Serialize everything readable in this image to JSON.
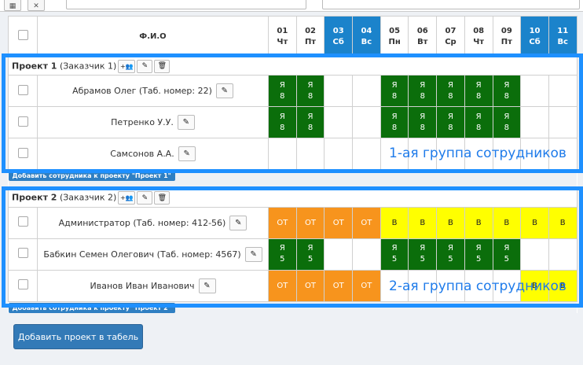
{
  "days": [
    {
      "num": "01",
      "dow": "Чт",
      "weekend": false
    },
    {
      "num": "02",
      "dow": "Пт",
      "weekend": false
    },
    {
      "num": "03",
      "dow": "Сб",
      "weekend": true
    },
    {
      "num": "04",
      "dow": "Вс",
      "weekend": true
    },
    {
      "num": "05",
      "dow": "Пн",
      "weekend": false
    },
    {
      "num": "06",
      "dow": "Вт",
      "weekend": false
    },
    {
      "num": "07",
      "dow": "Ср",
      "weekend": false
    },
    {
      "num": "08",
      "dow": "Чт",
      "weekend": false
    },
    {
      "num": "09",
      "dow": "Пт",
      "weekend": false
    },
    {
      "num": "10",
      "dow": "Сб",
      "weekend": true
    },
    {
      "num": "11",
      "dow": "Вс",
      "weekend": true
    }
  ],
  "header": {
    "fio": "Ф.И.О"
  },
  "projects": [
    {
      "name": "Проект 1",
      "customer": "(Заказчик 1)",
      "add_label": "Добавить сотрудника к проекту \"Проект 1\"",
      "note": "1-ая группа сотрудников",
      "employees": [
        {
          "name": "Абрамов Олег (Таб. номер: 22)",
          "cells": [
            [
              "Я",
              "8"
            ],
            [
              "Я",
              "8"
            ],
            null,
            null,
            [
              "Я",
              "8"
            ],
            [
              "Я",
              "8"
            ],
            [
              "Я",
              "8"
            ],
            [
              "Я",
              "8"
            ],
            [
              "Я",
              "8"
            ],
            null,
            null
          ],
          "kind": "ya"
        },
        {
          "name": "Петренко У.У.",
          "cells": [
            [
              "Я",
              "8"
            ],
            [
              "Я",
              "8"
            ],
            null,
            null,
            [
              "Я",
              "8"
            ],
            [
              "Я",
              "8"
            ],
            [
              "Я",
              "8"
            ],
            [
              "Я",
              "8"
            ],
            [
              "Я",
              "8"
            ],
            null,
            null
          ],
          "kind": "ya"
        },
        {
          "name": "Самсонов А.А.",
          "cells": [
            null,
            null,
            null,
            null,
            null,
            null,
            null,
            null,
            null,
            null,
            null
          ],
          "kind": "ya"
        }
      ]
    },
    {
      "name": "Проект 2",
      "customer": "(Заказчик 2)",
      "add_label": "Добавить сотрудника к проекту \"Проект 2\"",
      "note": "2-ая группа сотрудников",
      "employees": [
        {
          "name": "Администратор (Таб. номер: 412-56)",
          "cells": [
            [
              "ОТ",
              "ot"
            ],
            [
              "ОТ",
              "ot"
            ],
            [
              "ОТ",
              "ot"
            ],
            [
              "ОТ",
              "ot"
            ],
            [
              "В",
              "vv"
            ],
            [
              "В",
              "vv"
            ],
            [
              "В",
              "vv"
            ],
            [
              "В",
              "vv"
            ],
            [
              "В",
              "vv"
            ],
            [
              "В",
              "vv"
            ],
            [
              "В",
              "vv"
            ]
          ],
          "kind": "mixed"
        },
        {
          "name": "Бабкин Семен Олегович (Таб. номер: 4567)",
          "cells": [
            [
              "Я",
              "5"
            ],
            [
              "Я",
              "5"
            ],
            null,
            null,
            [
              "Я",
              "5"
            ],
            [
              "Я",
              "5"
            ],
            [
              "Я",
              "5"
            ],
            [
              "Я",
              "5"
            ],
            [
              "Я",
              "5"
            ],
            null,
            null
          ],
          "kind": "ya"
        },
        {
          "name": "Иванов Иван Иванович",
          "cells": [
            [
              "ОТ",
              "ot"
            ],
            [
              "ОТ",
              "ot"
            ],
            [
              "ОТ",
              "ot"
            ],
            [
              "ОТ",
              "ot"
            ],
            null,
            null,
            null,
            null,
            null,
            [
              "В",
              "vv"
            ],
            [
              "В",
              "vv"
            ]
          ],
          "kind": "mixed"
        }
      ]
    }
  ],
  "add_project_label": "Добавить проект в табель",
  "colors": {
    "ya": "#0b6e0b",
    "ot": "#f7941d",
    "vv": "#ffff00",
    "weekend_header": "#1b83cb",
    "frame": "#1e90ff"
  }
}
